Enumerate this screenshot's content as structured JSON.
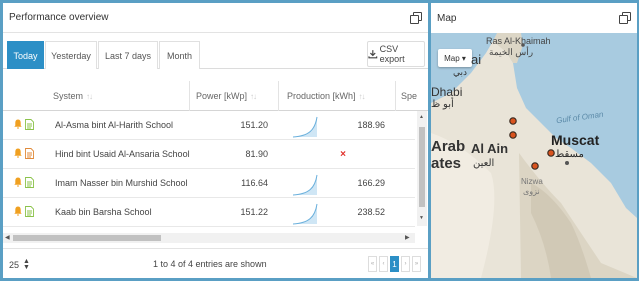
{
  "performance": {
    "title": "Performance overview",
    "tabs": [
      "Today",
      "Yesterday",
      "Last 7 days",
      "Month"
    ],
    "active_tab": "Today",
    "csv_label": "CSV export",
    "columns": {
      "system": "System",
      "power": "Power [kWp]",
      "production": "Production [kWh]",
      "spec": "Spe"
    },
    "rows": [
      {
        "system": "Al-Asma bint Al-Harith School",
        "power": "151.20",
        "production": "188.96",
        "status": "ok"
      },
      {
        "system": "Hind bint Usaid Al-Ansaria School",
        "power": "81.90",
        "production": "",
        "status": "error"
      },
      {
        "system": "Imam Nasser bin Murshid School",
        "power": "116.64",
        "production": "166.29",
        "status": "ok"
      },
      {
        "system": "Kaab bin Barsha School",
        "power": "151.22",
        "production": "238.52",
        "status": "ok"
      }
    ],
    "error_mark": "×",
    "page_size": "25",
    "entries_text": "1 to 4 of 4 entries are shown",
    "current_page": "1"
  },
  "map": {
    "title": "Map",
    "type_button": "Map ▾",
    "labels": {
      "ras_en": "Ras Al-Khaimah",
      "ras_ar": "رأس الخيمة",
      "dubai_ar": "دبي",
      "dubai_frag": "ai",
      "abu_dhabi": "Dhabi",
      "abu_dhabi_ar": "أبو ظ",
      "arab": "Arab",
      "ates": "ates",
      "al_ain": "Al Ain",
      "al_ain_ar": "العين",
      "gulf": "Gulf of Oman",
      "muscat": "Muscat",
      "muscat_ar": "مسقط",
      "nizwa": "Nizwa",
      "nizwa_ar": "نزوى"
    }
  },
  "colors": {
    "accent": "#2c8fc6",
    "frame": "#5a9fc4",
    "bell": "#f0a020",
    "doc_ok": "#8bc34a",
    "doc_error": "#e08a3a",
    "error_x": "#e0302a",
    "marker": "#d9531e"
  }
}
